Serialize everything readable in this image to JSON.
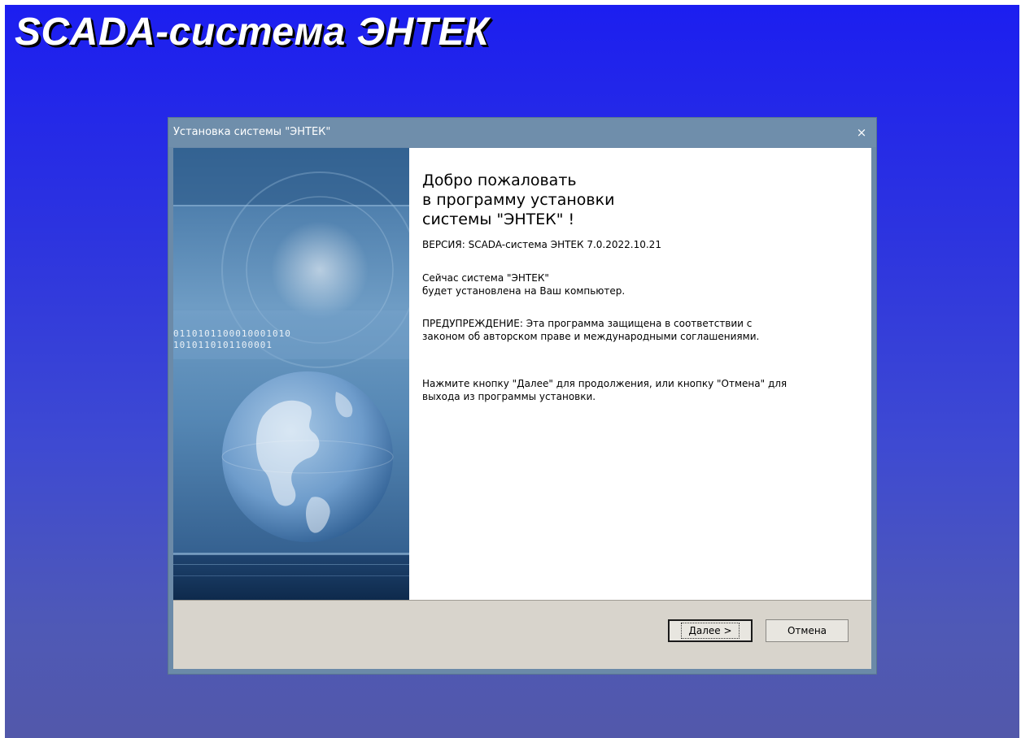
{
  "brand": {
    "title": "SCADA-система ЭНТЕК"
  },
  "window": {
    "title": "Установка системы \"ЭНТЕК\"",
    "close_label": "×"
  },
  "welcome": {
    "heading_lines": [
      "Добро пожаловать",
      "в программу установки",
      "системы \"ЭНТЕК\" !"
    ],
    "version": "ВЕРСИЯ:  SCADA-система ЭНТЕК 7.0.2022.10.21",
    "info_lines": [
      "Сейчас система \"ЭНТЕК\"",
      "будет установлена на Ваш компьютер."
    ],
    "warning_lines": [
      "ПРЕДУПРЕЖДЕНИЕ: Эта программа защищена в соответствии с",
      "законом об авторском праве и международными соглашениями."
    ],
    "instruction_lines": [
      "Нажмите кнопку \"Далее\" для продолжения, или кнопку \"Отмена\" для",
      "выхода из программы установки."
    ]
  },
  "side_art": {
    "binary_row_1": "0110101100010001010",
    "binary_row_2": "1010110101100001"
  },
  "buttons": {
    "next": "Далее >",
    "cancel": "Отмена"
  }
}
